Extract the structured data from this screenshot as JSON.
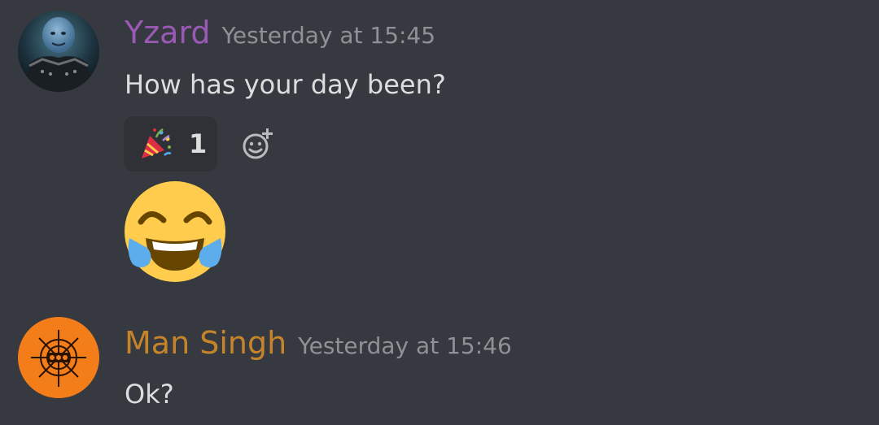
{
  "messages": [
    {
      "username": "Yzard",
      "username_color": "#9b59b6",
      "timestamp": "Yesterday at 15:45",
      "text": "How has your day been?",
      "avatar": "user-avatar-icon",
      "reactions": [
        {
          "emoji": "party-popper-icon",
          "count": "1"
        }
      ],
      "attachment_emoji": "face-with-tears-of-joy-icon"
    },
    {
      "username": "Man Singh",
      "username_color": "#c6842a",
      "timestamp": "Yesterday at 15:46",
      "text": "Ok?",
      "avatar": "orange-compass-avatar-icon"
    }
  ],
  "theme": {
    "background": "#36393f",
    "text": "#dcddde",
    "muted": "#8e9297",
    "reaction_bg": "#2f3136"
  }
}
